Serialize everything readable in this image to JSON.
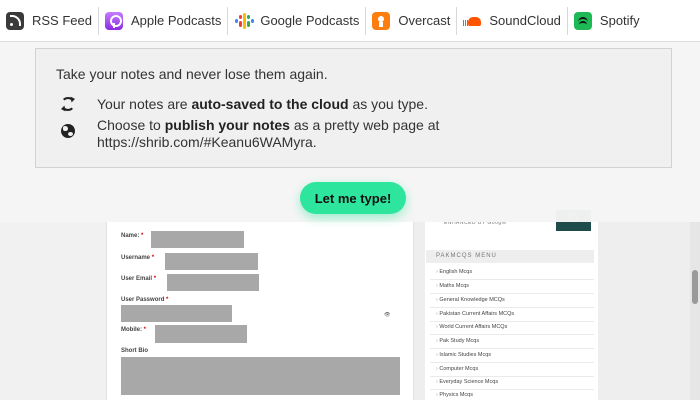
{
  "podcast_bar": {
    "items": [
      {
        "label": "RSS Feed",
        "icon": "rss-icon"
      },
      {
        "label": "Apple Podcasts",
        "icon": "apple-podcasts-icon"
      },
      {
        "label": "Google Podcasts",
        "icon": "google-podcasts-icon"
      },
      {
        "label": "Overcast",
        "icon": "overcast-icon"
      },
      {
        "label": "SoundCloud",
        "icon": "soundcloud-icon"
      },
      {
        "label": "Spotify",
        "icon": "spotify-icon"
      }
    ]
  },
  "notice": {
    "title": "Take your notes and never lose them again.",
    "row1": {
      "prefix": "Your notes are ",
      "bold": "auto-saved to the cloud",
      "suffix": " as you type.",
      "icon": "sync-icon"
    },
    "row2": {
      "prefix": "Choose to ",
      "bold": "publish your notes",
      "suffix": " as a pretty web page at",
      "line2": "https://shrib.com/#Keanu6WAMyra.",
      "icon": "globe-icon"
    }
  },
  "cta": {
    "label": "Let me type!",
    "color": "#2ee59d"
  },
  "background_page": {
    "form": {
      "name_label": "Name:",
      "username_label": "Username",
      "email_label": "User Email",
      "password_label": "User Password",
      "mobile_label": "Mobile:",
      "bio_label": "Short Bio",
      "required_mark": "*"
    },
    "sidebar": {
      "search_caption": "ENHANCED BY Google",
      "menu_title": "PAKMCQS MENU",
      "menu_items": [
        "English Mcqs",
        "Maths Mcqs",
        "General Knowledge MCQs",
        "Pakistan Current Affairs MCQs",
        "World Current Affairs MCQs",
        "Pak Study Mcqs",
        "Islamic Studies Mcqs",
        "Computer Mcqs",
        "Everyday Science Mcqs",
        "Physics Mcqs"
      ]
    }
  }
}
